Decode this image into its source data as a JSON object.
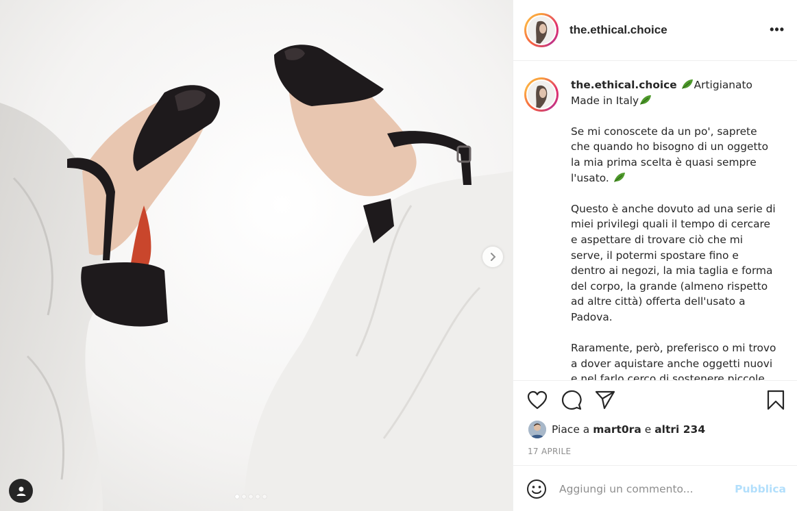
{
  "post": {
    "username": "the.ethical.choice",
    "more_label": "•••",
    "carousel": {
      "slide_count": 5,
      "active_index": 0
    }
  },
  "caption": {
    "username": "the.ethical.choice",
    "line1": "Artigianato",
    "line2": "Made in Italy",
    "para1": "Se mi conoscete da un po', saprete che quando ho bisogno di un oggetto la mia prima scelta è quasi sempre l'usato.",
    "para2": "Questo è anche dovuto ad una serie di miei privilegi quali il tempo di cercare e aspettare di trovare ciò che mi serve, il potermi spostare fino e dentro ai negozi, la mia taglia e forma del corpo, la grande (almeno rispetto ad altre città) offerta dell'usato a Padova.",
    "para3": "Raramente, però, preferisco o mi trovo a dover aquistare anche oggetti nuovi e nel farlo cerco di sostenere piccole"
  },
  "likes": {
    "prefix": "Piace a",
    "user": "mart0ra",
    "conjunction": "e",
    "others": "altri 234"
  },
  "date": "17 APRILE",
  "comment": {
    "placeholder": "Aggiungi un commento...",
    "publish_label": "Pubblica"
  },
  "colors": {
    "publish_disabled": "#b2dffc",
    "text": "#262626",
    "muted": "#8e8e8e",
    "leaf": "#4f9a2c"
  }
}
